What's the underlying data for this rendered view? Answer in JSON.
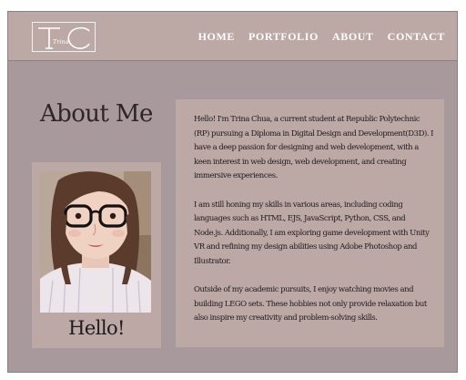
{
  "logo": {
    "letters": "TC",
    "subtext": "Trina"
  },
  "nav": [
    {
      "label": "HOME"
    },
    {
      "label": "PORTFOLIO"
    },
    {
      "label": "ABOUT"
    },
    {
      "label": "CONTACT"
    }
  ],
  "about": {
    "title": "About Me",
    "caption": "Hello!",
    "paragraphs": [
      "Hello! I'm Trina Chua, a current student at Republic Polytechnic (RP) pursuing a Diploma in Digital Design and Development(D3D). I have a deep passion for designing and web development, with a keen interest in web design, web development, and creating immersive experiences.",
      "I am still honing my skills in various areas, including coding languages such as HTML, EJS, JavaScript, Python, CSS, and Node.js. Additionally, I am exploring game development with Unity VR and refining my design abilities using Adobe Photoshop and Illustrator.",
      "Outside of my academic pursuits, I enjoy watching movies and building LEGO sets. These hobbies not only provide relaxation but also inspire my creativity and problem-solving skills."
    ]
  },
  "colors": {
    "page_bg": "#a89a9c",
    "card_bg": "#bca9a6",
    "nav_text": "#ffffff",
    "body_text": "#1f1a1c"
  }
}
